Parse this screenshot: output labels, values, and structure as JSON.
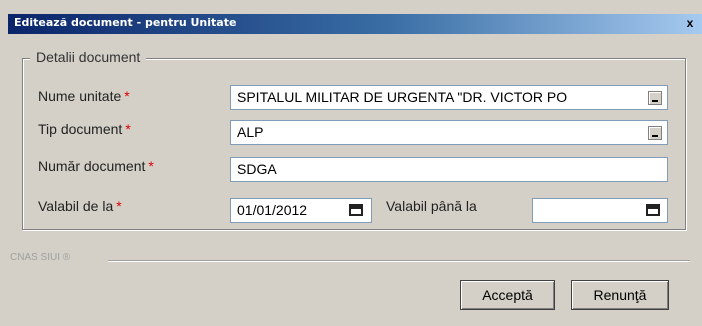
{
  "window": {
    "title": "Editează document - pentru Unitate",
    "close_label": "x"
  },
  "group": {
    "legend": "Detalii document"
  },
  "fields": {
    "nume_unitate": {
      "label": "Nume unitate",
      "value": "SPITALUL MILITAR DE URGENTA \"DR. VICTOR PO"
    },
    "tip_document": {
      "label": "Tip document",
      "value": "ALP"
    },
    "numar_document": {
      "label": "Număr document",
      "value": "SDGA"
    },
    "valabil_de_la": {
      "label": "Valabil de la",
      "value": "01/01/2012"
    },
    "valabil_pana_la": {
      "label": "Valabil până la",
      "value": ""
    }
  },
  "required_marker": "*",
  "footer": {
    "separator_text": "CNAS SIUI ®",
    "accept_label": "Acceptă",
    "cancel_label": "Renunţă"
  },
  "colors": {
    "title_bar_start": "#0a246a",
    "title_bar_end": "#a6caf0",
    "required": "#e00000",
    "face": "#d4d0c8"
  }
}
